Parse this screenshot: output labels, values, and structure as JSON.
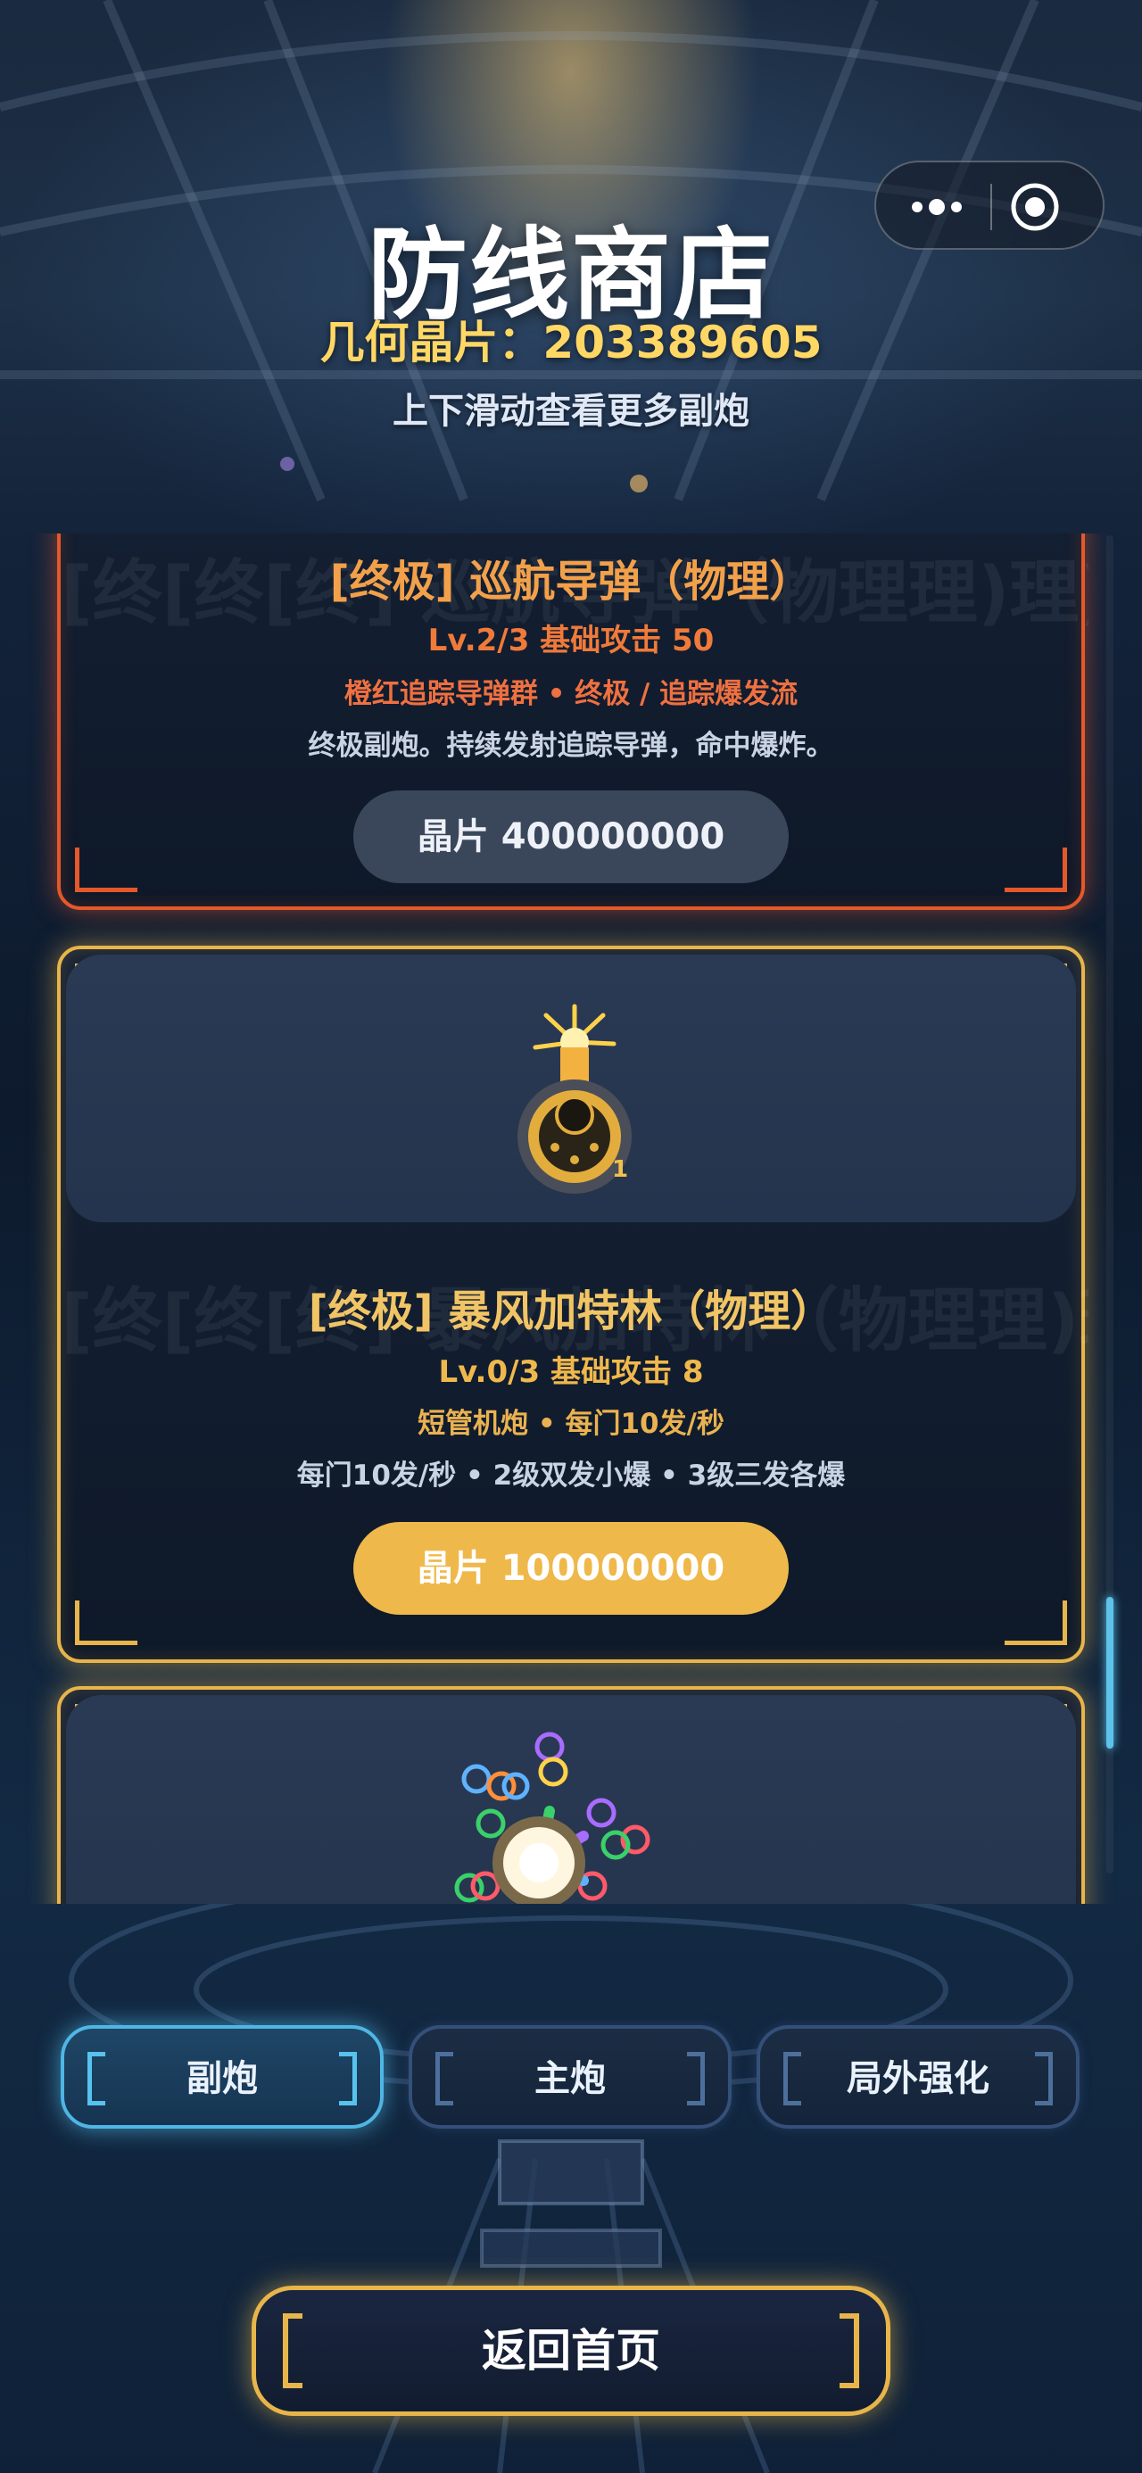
{
  "header": {
    "title": "防线商店",
    "currency_text": "几何晶片：203389605",
    "hint": "上下滑动查看更多副炮"
  },
  "capsule": {
    "more_icon": "more-dots-icon",
    "close_icon": "target-close-icon"
  },
  "cards": [
    {
      "watermark": "[终[终[终] 巡航导弹（物理理)理)",
      "name": "[终极] 巡航导弹（物理）",
      "level": "Lv.2/3  基础攻击 50",
      "tags": "橙红追踪导弹群 • 终极 / 追踪爆发流",
      "desc": "终极副炮。持续发射追踪导弹，命中爆炸。",
      "price": "晶片 400000000",
      "theme_color": "#e5582a"
    },
    {
      "watermark": "[终[终[终] 暴风加特林（物理理)理)",
      "name": "[终极] 暴风加特林（物理）",
      "level": "Lv.0/3  基础攻击 8",
      "tags": "短管机炮 • 每门10发/秒",
      "desc": "每门10发/秒 • 2级双发小爆 • 3级三发各爆",
      "price": "晶片 100000000",
      "count": "1",
      "icon": "gatling-turret-icon",
      "theme_color": "#e8b54a"
    },
    {
      "icon": "rainbow-burst-turret-icon",
      "theme_color": "#e8b54a"
    }
  ],
  "tabs": [
    {
      "label": "副炮",
      "active": true
    },
    {
      "label": "主炮",
      "active": false
    },
    {
      "label": "局外强化",
      "active": false
    }
  ],
  "back_button": "返回首页",
  "colors": {
    "accent_gold": "#e8b54a",
    "accent_orange": "#e5582a",
    "accent_blue": "#4fb6e4",
    "currency_yellow": "#ffd765"
  }
}
